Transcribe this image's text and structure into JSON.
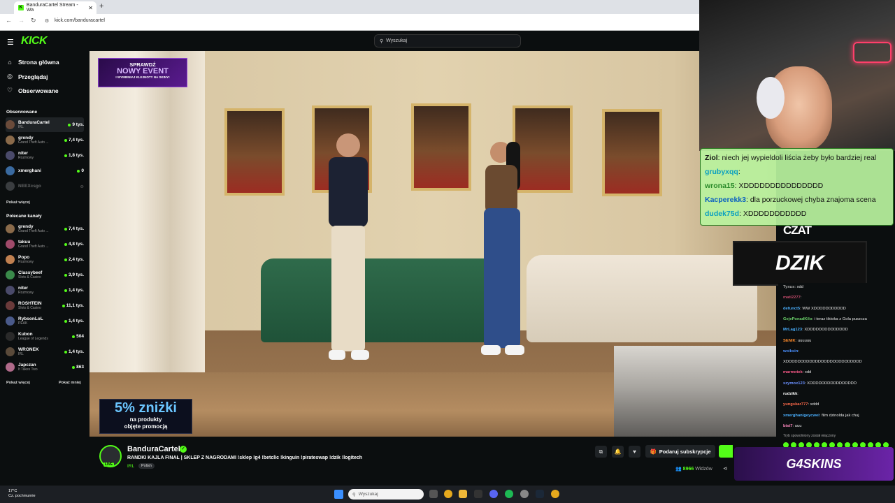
{
  "browser": {
    "tab_title": "BanduraCartel Stream - Wa",
    "new_tab": "+",
    "url": "kick.com/banduracartel"
  },
  "header": {
    "logo": "KICK",
    "search_placeholder": "Wyszukaj"
  },
  "sidebar": {
    "nav": [
      {
        "label": "Strona główna",
        "icon": "home-icon"
      },
      {
        "label": "Przeglądaj",
        "icon": "compass-icon"
      },
      {
        "label": "Obserwowane",
        "icon": "heart-icon"
      }
    ],
    "followed_heading": "Obserwowane",
    "followed": [
      {
        "name": "BanduraCartel",
        "category": "IRL",
        "viewers": "9 tys.",
        "color": "#6b4b3a"
      },
      {
        "name": "grendy",
        "category": "Grand Theft Auto ...",
        "viewers": "7,4 tys.",
        "color": "#8a6a4a"
      },
      {
        "name": "niter",
        "category": "Rozmowy",
        "viewers": "1,8 tys.",
        "color": "#4a4a6a"
      },
      {
        "name": "xmerghani",
        "category": "",
        "viewers": "0",
        "color": "#3a6aa0"
      },
      {
        "name": "NEEXcsgo",
        "category": "",
        "viewers": "",
        "color": "#3a3d40"
      }
    ],
    "show_more": "Pokaż więcej",
    "recommended_heading": "Polecane kanały",
    "recommended": [
      {
        "name": "grendy",
        "category": "Grand Theft Auto ...",
        "viewers": "7,4 tys.",
        "color": "#8a6a4a"
      },
      {
        "name": "takuu",
        "category": "Grand Theft Auto ...",
        "viewers": "4,8 tys.",
        "color": "#a04a6a"
      },
      {
        "name": "Popo",
        "category": "Rozmowy",
        "viewers": "2,4 tys.",
        "color": "#c08050"
      },
      {
        "name": "Classybeef",
        "category": "Slots & Casino",
        "viewers": "3,9 tys.",
        "color": "#3a8a4a"
      },
      {
        "name": "niter",
        "category": "Rozmowy",
        "viewers": "1,4 tys.",
        "color": "#4a4a6a"
      },
      {
        "name": "ROSHTEIN",
        "category": "Slots & Casino",
        "viewers": "11,1 tys.",
        "color": "#6a3a3a"
      },
      {
        "name": "RybsonLoL",
        "category": "PEAK",
        "viewers": "1,4 tys.",
        "color": "#4a5a8a"
      },
      {
        "name": "Kubon",
        "category": "League of Legends",
        "viewers": "504",
        "color": "#2a2a2a"
      },
      {
        "name": "WRONEK",
        "category": "IRL",
        "viewers": "1,4 tys.",
        "color": "#5a4a3a"
      },
      {
        "name": "Japczan",
        "category": "It Takes Two",
        "viewers": "863",
        "color": "#b06a8a"
      }
    ],
    "show_more_2": "Pokaż więcej",
    "show_less": "Pokaż mniej"
  },
  "overlays": {
    "promo_top": {
      "l1": "SPRAWDŹ",
      "l2": "NOWY EVENT",
      "l3": "I WYMIENIAJ KLEJNOTY NA SKINY!"
    },
    "promo_bottom": {
      "p1": "5% zniżki",
      "p2a": "na produkty",
      "p2b": "objęte promocją"
    },
    "czat_label": "CZAT",
    "dzik_logo": "DZIK",
    "g4_logo": "G4SKINS"
  },
  "big_chat": [
    {
      "user": "Ziol",
      "text": "niech jej wypieldoli liścia żeby było bardziej real",
      "color": "#111111"
    },
    {
      "user": "grubyxqq",
      "text": "",
      "color": "#0aa0c0"
    },
    {
      "user": "wrona15",
      "text": "XDDDDDDDDDDDDDDD",
      "color": "#2a8a2a"
    },
    {
      "user": "Kacperekk3",
      "text": "dla porzuckowej chyba znajoma scena",
      "color": "#0a60c0"
    },
    {
      "user": "dudek75d",
      "text": "XDDDDDDDDDDD",
      "color": "#0aa0c0"
    }
  ],
  "small_chat": [
    {
      "user": "Tyxus",
      "text": "xdd",
      "color": "#aaaaaa"
    },
    {
      "user": "mati2277",
      "text": "",
      "color": "#c04a6a"
    },
    {
      "user": "defunct5",
      "text": "WW XDDDDDDDDDDD",
      "color": "#4ab0ff"
    },
    {
      "user": "GejePonadKilo",
      "text": "i teraz tiktoka z Gola puszcza",
      "color": "#6ad06a"
    },
    {
      "user": "MrLag123",
      "text": "XDDDDDDDDDDDDDD",
      "color": "#4ab0ff"
    },
    {
      "user": "SENIK",
      "text": "uuuuuu",
      "color": "#ff8a2a"
    },
    {
      "user": "woiksin",
      "text": "",
      "color": "#4a90ff"
    },
    {
      "user": "",
      "text": "XDDDDDDDDDDDDDDDDDDDDDDDDDD",
      "color": "#ffffff"
    },
    {
      "user": "marmotek",
      "text": "xdd",
      "color": "#ff5a8a"
    },
    {
      "user": "szymox123",
      "text": "XDDDDDDDDDDDDDDDD",
      "color": "#6a90ff"
    },
    {
      "user": "rudzikk",
      "text": "",
      "color": "#ffffff"
    },
    {
      "user": "yungskar777",
      "text": "xddd",
      "color": "#ff6a4a"
    },
    {
      "user": "xmerghanigeycwei",
      "text": "film dzinolda jak chuj",
      "color": "#4ab0ff"
    },
    {
      "user": "bist7",
      "text": "uuu",
      "color": "#ff8ac0"
    }
  ],
  "chat_system": "Tryb spowolniony został włączony",
  "stream": {
    "streamer": "BanduraCartel",
    "title": "RANDKI KAJLA FINAŁ | SKLEP Z NAGRODAMI !sklep !g4 !betclic !kinguin !pirateswap !dzik !logitech",
    "category": "IRL",
    "tag": "Polish",
    "live": "LIVE",
    "subscribe_label": "Podaruj subskrypcje",
    "viewers": "8966",
    "viewers_label": "Widzów"
  },
  "taskbar": {
    "temp": "17°C",
    "weather": "Cz. pochmurnie",
    "search_placeholder": "Wyszukaj"
  },
  "colors": {
    "accent": "#53fc18",
    "bg": "#0b0e0f"
  }
}
